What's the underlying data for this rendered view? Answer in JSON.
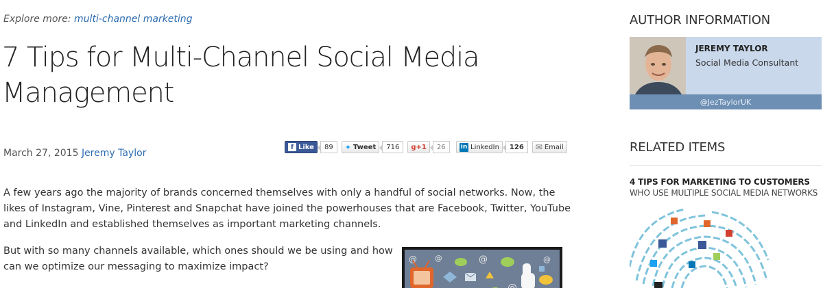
{
  "article": {
    "explore_prefix": "Explore more:",
    "explore_link": "multi-channel marketing",
    "title": "7 Tips for Multi-Channel Social Media Management",
    "date": "March 27, 2015",
    "author_link": "Jeremy Taylor",
    "paragraph1": "A few years ago the majority of brands concerned themselves with only a handful of social networks. Now, the likes of Instagram, Vine, Pinterest and Snapchat have joined the powerhouses that are Facebook, Twitter, YouTube and LinkedIn and established themselves as important marketing channels.",
    "paragraph2": "But with so many channels available, which ones should we be using and how can we optimize our messaging to maximize impact?"
  },
  "share": {
    "facebook_label": "Like",
    "facebook_icon": "f",
    "facebook_count": "89",
    "twitter_label": "Tweet",
    "twitter_count": "716",
    "gplus_label": "g+1",
    "gplus_count": "26",
    "linkedin_icon": "in",
    "linkedin_label": "LinkedIn",
    "linkedin_count": "126",
    "email_label": "Email"
  },
  "sidebar": {
    "author_heading": "AUTHOR INFORMATION",
    "author_name": "JEREMY TAYLOR",
    "author_role": "Social Media Consultant",
    "author_handle": "@JezTaylorUK",
    "related_heading": "RELATED ITEMS",
    "related_title": "4 TIPS FOR MARKETING TO CUSTOMERS",
    "related_subtitle": "WHO USE MULTIPLE SOCIAL MEDIA NETWORKS"
  },
  "colors": {
    "link": "#2b6cb0",
    "facebook": "#3b5998",
    "twitter": "#1da1f2",
    "gplus": "#d23f31",
    "linkedin": "#0077b5",
    "author_card": "#c9d8eb",
    "author_bar": "#6d8fb3"
  }
}
